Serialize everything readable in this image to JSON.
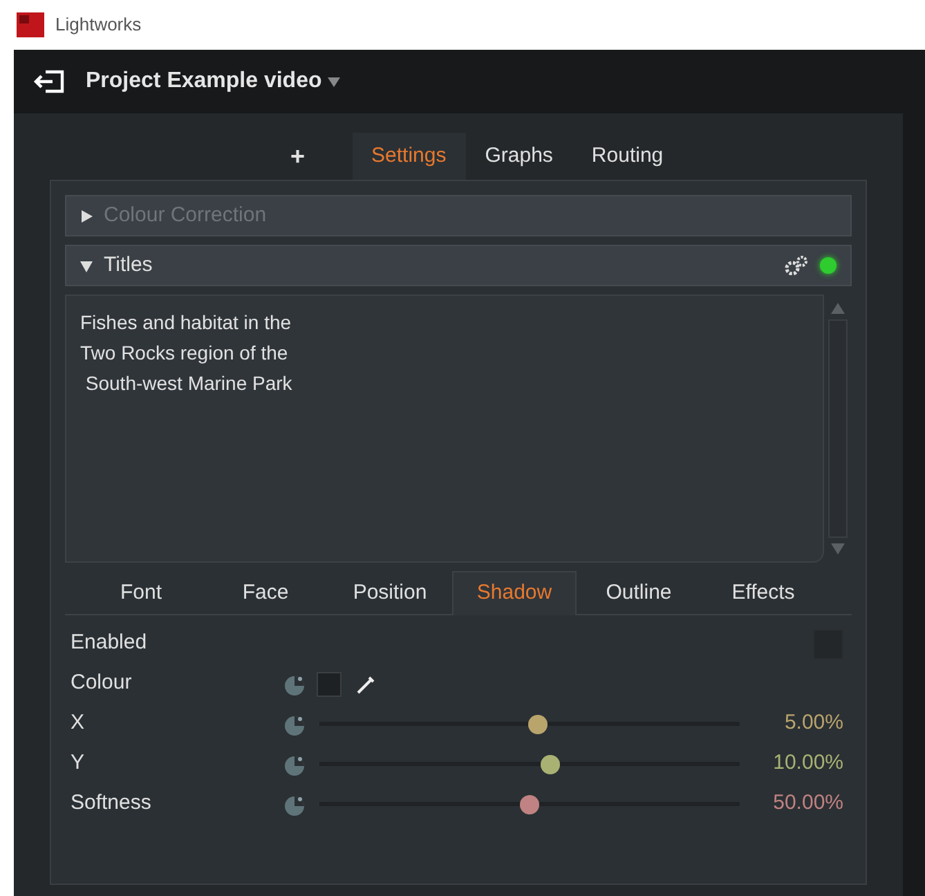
{
  "window": {
    "title": "Lightworks"
  },
  "project": {
    "title": "Project Example video"
  },
  "tabs": [
    {
      "label": "+",
      "selected": false
    },
    {
      "label": "Settings",
      "selected": true
    },
    {
      "label": "Graphs",
      "selected": false
    },
    {
      "label": "Routing",
      "selected": false
    }
  ],
  "sections": [
    {
      "title": "Colour Correction",
      "expanded": false,
      "disabled": true
    },
    {
      "title": "Titles",
      "expanded": true,
      "disabled": false,
      "enabled_indicator": true
    }
  ],
  "title_text": [
    "Fishes and habitat in the",
    "Two Rocks region of the",
    " South-west Marine Park"
  ],
  "subtabs": [
    {
      "label": "Font",
      "selected": false
    },
    {
      "label": "Face",
      "selected": false
    },
    {
      "label": "Position",
      "selected": false
    },
    {
      "label": "Shadow",
      "selected": true
    },
    {
      "label": "Outline",
      "selected": false
    },
    {
      "label": "Effects",
      "selected": false
    }
  ],
  "rows": [
    {
      "kind": "checkbox",
      "label": "Enabled",
      "checked": false
    },
    {
      "kind": "colour",
      "label": "Colour",
      "color": "#1e2124"
    },
    {
      "kind": "slider",
      "label": "X",
      "level": 0.52,
      "reading": "5.00%",
      "color": "#b9a46c"
    },
    {
      "kind": "slider",
      "label": "Y",
      "level": 0.55,
      "reading": "10.00%",
      "color": "#a9b273"
    },
    {
      "kind": "slider",
      "label": "Softness",
      "level": 0.5,
      "reading": "50.00%",
      "color": "#c08282"
    }
  ]
}
